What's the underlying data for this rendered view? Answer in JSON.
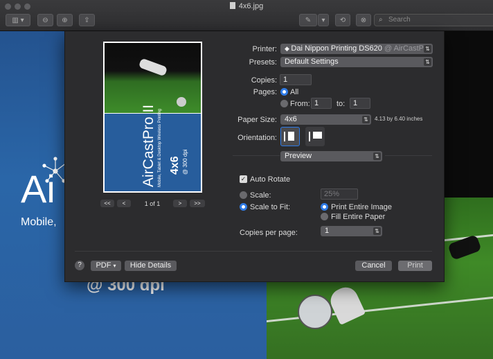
{
  "window": {
    "title": "4x6.jpg"
  },
  "toolbar": {
    "search_placeholder": "Search"
  },
  "background": {
    "logo_fragment": "Ai",
    "subtitle_fragment": "Mobile, ",
    "dpi_text": "@ 300 dpi"
  },
  "preview": {
    "thumb_brand": "AirCastPro II",
    "thumb_tagline": "Mobile, Tablet & Desktop Wireless Printing",
    "thumb_size": "4x6",
    "thumb_dpi": "@ 300 dpi",
    "page_indicator": "1 of 1",
    "nav_first": "<<",
    "nav_prev": "<",
    "nav_next": ">",
    "nav_last": ">>"
  },
  "print": {
    "printer_label": "Printer:",
    "printer_value": "Dai Nippon Printing DS620",
    "printer_suffix": "@ AirCastPro",
    "presets_label": "Presets:",
    "presets_value": "Default Settings",
    "copies_label": "Copies:",
    "copies_value": "1",
    "pages_label": "Pages:",
    "pages_all": "All",
    "pages_from": "From:",
    "pages_from_value": "1",
    "pages_to": "to:",
    "pages_to_value": "1",
    "paper_label": "Paper Size:",
    "paper_value": "4x6",
    "paper_dims": "4.13 by 6.40 inches",
    "orientation_label": "Orientation:",
    "section_popup": "Preview",
    "auto_rotate": "Auto Rotate",
    "scale_label": "Scale:",
    "scale_value": "25%",
    "scale_to_fit": "Scale to Fit:",
    "print_entire_image": "Print Entire Image",
    "fill_entire_paper": "Fill Entire Paper",
    "copies_per_page_label": "Copies per page:",
    "copies_per_page_value": "1"
  },
  "footer": {
    "help": "?",
    "pdf": "PDF",
    "hide_details": "Hide Details",
    "cancel": "Cancel",
    "print": "Print"
  }
}
